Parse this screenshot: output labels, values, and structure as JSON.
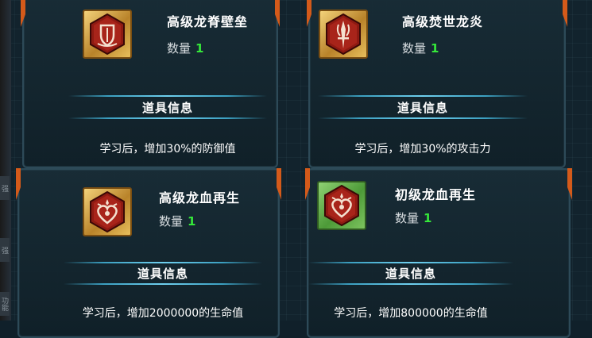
{
  "section_title": "道具信息",
  "quantity_label": "数量",
  "items": [
    {
      "name": "高级龙脊壁垒",
      "quantity": "1",
      "effect": "学习后，增加30%的防御值",
      "icon": "shield-icon",
      "frame_color": "gold"
    },
    {
      "name": "高级焚世龙炎",
      "quantity": "1",
      "effect": "学习后，增加30%的攻击力",
      "icon": "flame-sword-icon",
      "frame_color": "gold"
    },
    {
      "name": "高级龙血再生",
      "quantity": "1",
      "effect": "学习后，增加2000000的生命值",
      "icon": "heart-icon",
      "frame_color": "gold"
    },
    {
      "name": "初级龙血再生",
      "quantity": "1",
      "effect": "学习后，增加800000的生命值",
      "icon": "heart-icon",
      "frame_color": "green"
    }
  ],
  "left_tabs": [
    "强",
    "强",
    "功能"
  ],
  "colors": {
    "accent": "#d45a1a",
    "quantity": "#35e83a",
    "divider": "#6fd0ef",
    "gold_frame": "#e7be5b",
    "green_frame": "#7cc35e",
    "hex_red": "#8e1a12"
  }
}
